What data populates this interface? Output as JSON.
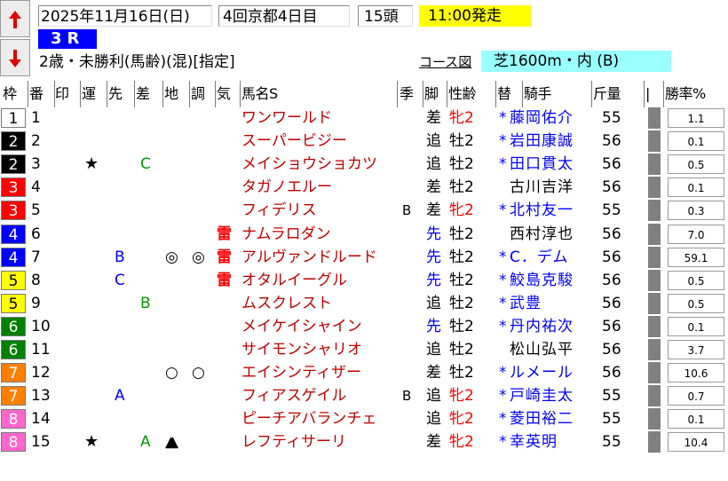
{
  "header": {
    "date": "2025年11月16日(日)",
    "meeting": "4回京都4日目",
    "heads": "15頭",
    "start_time": "11:00発走",
    "race_number": "3R",
    "conditions": "2歳・未勝利(馬齢)(混)[指定]",
    "course_label": "コース図",
    "course": "芝1600m・内 (B)"
  },
  "columns": [
    "枠",
    "番",
    "印",
    "運",
    "先",
    "差",
    "地",
    "調",
    "気",
    "馬名S",
    "季",
    "脚",
    "性齢",
    "替",
    "騎手",
    "斤量",
    "|",
    "勝率%"
  ],
  "colors": {
    "start_bg": "#ffff00",
    "race_bg": "#0000ff",
    "course_bg": "#99ffff",
    "accent_red": "#ff0000",
    "accent_blue": "#0000ff",
    "accent_green": "#009900"
  },
  "rows": [
    {
      "waku": "1",
      "num": "1",
      "mark": "",
      "un": "",
      "saki": "",
      "sa": "",
      "chi": "",
      "cho": "",
      "ki": "",
      "name": "ワンワールド",
      "season": "",
      "style": "差",
      "sexage": "牝2",
      "change": "*",
      "jockey": "藤岡佑介",
      "weight": "55",
      "pct": "1.1"
    },
    {
      "waku": "2",
      "num": "2",
      "mark": "",
      "un": "",
      "saki": "",
      "sa": "",
      "chi": "",
      "cho": "",
      "ki": "",
      "name": "スーパービジー",
      "season": "",
      "style": "追",
      "sexage": "牡2",
      "change": "*",
      "jockey": "岩田康誠",
      "weight": "56",
      "pct": "0.1"
    },
    {
      "waku": "2",
      "num": "3",
      "mark": "★",
      "un": "",
      "saki": "C",
      "sa": "",
      "chi": "",
      "cho": "",
      "ki": "",
      "name": "メイショウショカツ",
      "season": "",
      "style": "追",
      "sexage": "牡2",
      "change": "*",
      "jockey": "田口貫太",
      "weight": "56",
      "pct": "0.5"
    },
    {
      "waku": "3",
      "num": "4",
      "mark": "",
      "un": "",
      "saki": "",
      "sa": "",
      "chi": "",
      "cho": "",
      "ki": "",
      "name": "タガノエルー",
      "season": "",
      "style": "差",
      "sexage": "牡2",
      "change": "",
      "jockey": "古川吉洋",
      "weight": "56",
      "pct": "0.1"
    },
    {
      "waku": "3",
      "num": "5",
      "mark": "",
      "un": "",
      "saki": "",
      "sa": "",
      "chi": "",
      "cho": "",
      "ki": "",
      "name": "フィデリス",
      "season": "B",
      "style": "差",
      "sexage": "牝2",
      "change": "*",
      "jockey": "北村友一",
      "weight": "55",
      "pct": "0.3"
    },
    {
      "waku": "4",
      "num": "6",
      "mark": "",
      "un": "",
      "saki": "",
      "sa": "",
      "chi": "",
      "cho": "",
      "ki": "雷",
      "name": "ナムラロダン",
      "season": "",
      "style": "先",
      "sexage": "牡2",
      "change": "",
      "jockey": "西村淳也",
      "weight": "56",
      "pct": "7.0"
    },
    {
      "waku": "4",
      "num": "7",
      "mark": "",
      "un": "B",
      "saki": "",
      "sa": "",
      "chi": "◎",
      "cho": "◎",
      "ki": "雷",
      "name": "アルヴァンドルード",
      "season": "",
      "style": "先",
      "sexage": "牡2",
      "change": "*",
      "jockey": "C．デム",
      "weight": "56",
      "pct": "59.1"
    },
    {
      "waku": "5",
      "num": "8",
      "mark": "",
      "un": "C",
      "saki": "",
      "sa": "",
      "chi": "",
      "cho": "",
      "ki": "雷",
      "name": "オタルイーグル",
      "season": "",
      "style": "先",
      "sexage": "牡2",
      "change": "*",
      "jockey": "鮫島克駿",
      "weight": "56",
      "pct": "0.5"
    },
    {
      "waku": "5",
      "num": "9",
      "mark": "",
      "un": "",
      "saki": "B",
      "sa": "",
      "chi": "",
      "cho": "",
      "ki": "",
      "name": "ムスクレスト",
      "season": "",
      "style": "追",
      "sexage": "牡2",
      "change": "*",
      "jockey": "武豊",
      "weight": "56",
      "pct": "0.5"
    },
    {
      "waku": "6",
      "num": "10",
      "mark": "",
      "un": "",
      "saki": "",
      "sa": "",
      "chi": "",
      "cho": "",
      "ki": "",
      "name": "メイケイシャイン",
      "season": "",
      "style": "先",
      "sexage": "牡2",
      "change": "*",
      "jockey": "丹内祐次",
      "weight": "56",
      "pct": "0.1"
    },
    {
      "waku": "6",
      "num": "11",
      "mark": "",
      "un": "",
      "saki": "",
      "sa": "",
      "chi": "",
      "cho": "",
      "ki": "",
      "name": "サイモンシャリオ",
      "season": "",
      "style": "追",
      "sexage": "牡2",
      "change": "",
      "jockey": "松山弘平",
      "weight": "56",
      "pct": "3.7"
    },
    {
      "waku": "7",
      "num": "12",
      "mark": "",
      "un": "",
      "saki": "",
      "sa": "",
      "chi": "○",
      "cho": "○",
      "ki": "",
      "name": "エイシンティザー",
      "season": "",
      "style": "差",
      "sexage": "牡2",
      "change": "*",
      "jockey": "ルメール",
      "weight": "56",
      "pct": "10.6"
    },
    {
      "waku": "7",
      "num": "13",
      "mark": "",
      "un": "A",
      "saki": "",
      "sa": "",
      "chi": "",
      "cho": "",
      "ki": "",
      "name": "フィアスゲイル",
      "season": "B",
      "style": "追",
      "sexage": "牝2",
      "change": "*",
      "jockey": "戸崎圭太",
      "weight": "55",
      "pct": "0.7"
    },
    {
      "waku": "8",
      "num": "14",
      "mark": "",
      "un": "",
      "saki": "",
      "sa": "",
      "chi": "",
      "cho": "",
      "ki": "",
      "name": "ピーチアバランチェ",
      "season": "",
      "style": "追",
      "sexage": "牝2",
      "change": "*",
      "jockey": "菱田裕二",
      "weight": "55",
      "pct": "0.1"
    },
    {
      "waku": "8",
      "num": "15",
      "mark": "★",
      "un": "",
      "saki": "A",
      "sa": "▲",
      "chi": "▲",
      "cho": "",
      "ki": "",
      "name": "レフティサーリ",
      "season": "",
      "style": "差",
      "sexage": "牝2",
      "change": "*",
      "jockey": "幸英明",
      "weight": "55",
      "pct": "10.4"
    }
  ]
}
